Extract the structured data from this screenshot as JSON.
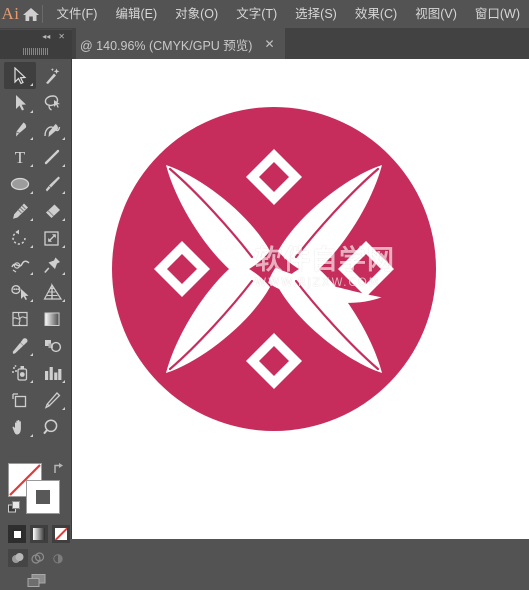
{
  "app": {
    "logo_text": "Ai",
    "home_icon": "home-icon"
  },
  "menubar": {
    "items": [
      {
        "label": "文件(F)",
        "name": "menu-file"
      },
      {
        "label": "编辑(E)",
        "name": "menu-edit"
      },
      {
        "label": "对象(O)",
        "name": "menu-object"
      },
      {
        "label": "文字(T)",
        "name": "menu-type"
      },
      {
        "label": "选择(S)",
        "name": "menu-select"
      },
      {
        "label": "效果(C)",
        "name": "menu-effect"
      },
      {
        "label": "视图(V)",
        "name": "menu-view"
      },
      {
        "label": "窗口(W)",
        "name": "menu-window"
      }
    ]
  },
  "document_tab": {
    "title": "@ 140.96% (CMYK/GPU 预览)",
    "zoom_level": "140.96%",
    "color_mode": "CMYK",
    "preview_mode": "GPU 预览",
    "close_label": "✕"
  },
  "panel_stub": {
    "collapse_label": "◂◂",
    "close_label": "✕"
  },
  "toolbar": {
    "tools": [
      {
        "name": "selection-tool",
        "label": "选择工具",
        "active": true,
        "has_flyout": true
      },
      {
        "name": "magic-wand-tool",
        "label": "魔棒工具",
        "active": false,
        "has_flyout": false
      },
      {
        "name": "direct-selection-tool",
        "label": "直接选择工具",
        "active": false,
        "has_flyout": true
      },
      {
        "name": "lasso-tool",
        "label": "套索工具",
        "active": false,
        "has_flyout": false
      },
      {
        "name": "pen-tool",
        "label": "钢笔工具",
        "active": false,
        "has_flyout": true
      },
      {
        "name": "curvature-tool",
        "label": "曲率工具",
        "active": false,
        "has_flyout": true
      },
      {
        "name": "type-tool",
        "label": "文字工具",
        "active": false,
        "has_flyout": true
      },
      {
        "name": "line-segment-tool",
        "label": "直线段工具",
        "active": false,
        "has_flyout": true
      },
      {
        "name": "ellipse-tool",
        "label": "椭圆工具",
        "active": false,
        "has_flyout": true
      },
      {
        "name": "paintbrush-tool",
        "label": "画笔工具",
        "active": false,
        "has_flyout": true
      },
      {
        "name": "shaper-tool",
        "label": "Shaper 工具",
        "active": false,
        "has_flyout": true
      },
      {
        "name": "eraser-tool",
        "label": "橡皮擦工具",
        "active": false,
        "has_flyout": true
      },
      {
        "name": "rotate-tool",
        "label": "旋转工具",
        "active": false,
        "has_flyout": true
      },
      {
        "name": "scale-tool",
        "label": "比例缩放工具",
        "active": false,
        "has_flyout": true
      },
      {
        "name": "width-tool",
        "label": "宽度工具",
        "active": false,
        "has_flyout": true
      },
      {
        "name": "free-transform-tool",
        "label": "自由变换工具",
        "active": false,
        "has_flyout": true
      },
      {
        "name": "shape-builder-tool",
        "label": "形状生成器工具",
        "active": false,
        "has_flyout": true
      },
      {
        "name": "perspective-grid-tool",
        "label": "透视网格工具",
        "active": false,
        "has_flyout": true
      },
      {
        "name": "mesh-tool",
        "label": "网格工具",
        "active": false,
        "has_flyout": false
      },
      {
        "name": "gradient-tool",
        "label": "渐变工具",
        "active": false,
        "has_flyout": false
      },
      {
        "name": "eyedropper-tool",
        "label": "吸管工具",
        "active": false,
        "has_flyout": true
      },
      {
        "name": "blend-tool",
        "label": "混合工具",
        "active": false,
        "has_flyout": false
      },
      {
        "name": "symbol-sprayer-tool",
        "label": "符号喷枪工具",
        "active": false,
        "has_flyout": true
      },
      {
        "name": "column-graph-tool",
        "label": "柱形图工具",
        "active": false,
        "has_flyout": true
      },
      {
        "name": "artboard-tool",
        "label": "画板工具",
        "active": false,
        "has_flyout": false
      },
      {
        "name": "slice-tool",
        "label": "切片工具",
        "active": false,
        "has_flyout": true
      },
      {
        "name": "hand-tool",
        "label": "抓手工具",
        "active": false,
        "has_flyout": true
      },
      {
        "name": "zoom-tool",
        "label": "缩放工具",
        "active": false,
        "has_flyout": false
      }
    ],
    "color_controls": {
      "fill_label": "填色",
      "fill_value": "无",
      "stroke_label": "描边",
      "stroke_value": "#585858",
      "swap_label": "互换填色和描边",
      "default_label": "默认填色和描边"
    },
    "fill_modes": [
      {
        "name": "color-mode-button",
        "label": "颜色",
        "selected": true
      },
      {
        "name": "gradient-mode-button",
        "label": "渐变",
        "selected": false
      },
      {
        "name": "none-mode-button",
        "label": "无",
        "selected": false
      }
    ],
    "draw_modes": [
      {
        "name": "draw-normal-button",
        "label": "正常绘图",
        "selected": true
      },
      {
        "name": "draw-behind-button",
        "label": "背面绘图",
        "selected": false
      },
      {
        "name": "draw-inside-button",
        "label": "内部绘图",
        "selected": false
      }
    ],
    "screen_mode": {
      "name": "screen-mode-button",
      "label": "更改屏幕模式"
    }
  },
  "canvas": {
    "artwork": {
      "name": "circle-ornament-artwork",
      "circle_color": "#c62d5c",
      "ornament_color": "#ffffff",
      "petal_count": 4,
      "diamond_count": 4
    },
    "watermark": {
      "main_text": "软件自学网",
      "sub_text": "WWW.RJZXW.COM"
    }
  },
  "colors": {
    "chrome_bg": "#535353",
    "tabbar_bg": "#424242",
    "canvas_bg": "#ffffff",
    "accent_orange": "#e89a6e",
    "artwork_pink": "#c62d5c"
  }
}
